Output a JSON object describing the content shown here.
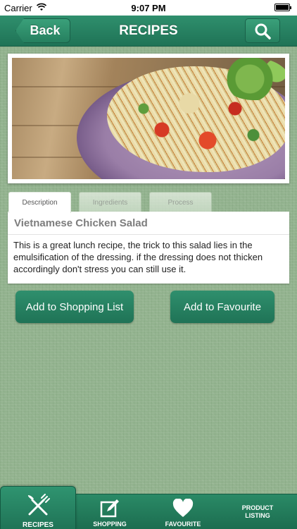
{
  "status_bar": {
    "carrier": "Carrier",
    "time": "9:07 PM",
    "wifi_icon": "wifi-icon",
    "battery_icon": "battery-icon",
    "battery_level": 1.0
  },
  "nav": {
    "back_label": "Back",
    "title": "RECIPES",
    "search_icon": "search-icon"
  },
  "recipe": {
    "image_alt": "salad-photo",
    "tabs": [
      {
        "label": "Description",
        "active": true
      },
      {
        "label": "Ingredients",
        "active": false
      },
      {
        "label": "Process",
        "active": false
      }
    ],
    "title": "Vietnamese Chicken Salad",
    "description": "This is a great lunch recipe, the trick to this salad lies in the emulsification of the dressing. if the dressing does not thicken accordingly don't stress you can still use it."
  },
  "actions": {
    "shopping_list_label": "Add to Shopping List",
    "favourite_label": "Add to Favourite"
  },
  "tab_bar": {
    "items": [
      {
        "label": "RECIPES",
        "icon": "fork-knife-icon",
        "selected": true
      },
      {
        "label": "SHOPPING",
        "icon": "edit-icon",
        "selected": false
      },
      {
        "label": "FAVOURITE",
        "icon": "heart-icon",
        "selected": false
      },
      {
        "label_line1": "PRODUCT",
        "label_line2": "LISTING",
        "selected": false
      }
    ]
  },
  "colors": {
    "accent": "#26805f",
    "background": "#93b38f"
  }
}
